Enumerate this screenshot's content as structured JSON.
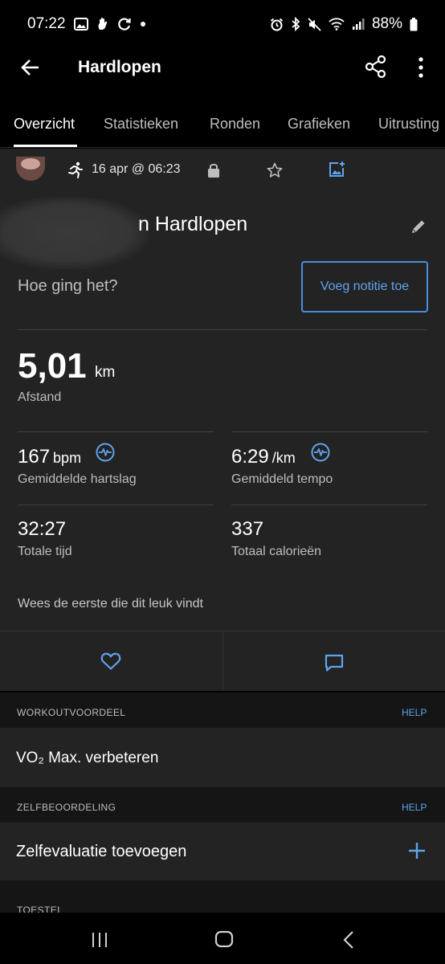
{
  "status_bar": {
    "time": "07:22",
    "battery": "88%",
    "left_icons": [
      "image-icon",
      "hand-icon",
      "sync-icon",
      "dot-icon"
    ],
    "right_icons": [
      "alarm-icon",
      "bluetooth-icon",
      "mute-icon",
      "wifi-icon",
      "signal-icon",
      "battery-icon"
    ]
  },
  "app_bar": {
    "title": "Hardlopen"
  },
  "tabs": [
    {
      "label": "Overzicht",
      "active": true
    },
    {
      "label": "Statistieken"
    },
    {
      "label": "Ronden"
    },
    {
      "label": "Grafieken"
    },
    {
      "label": "Uitrusting"
    }
  ],
  "activity": {
    "date": "16 apr @ 06:23",
    "name": "n Hardlopen",
    "feeling_prompt": "Hoe ging het?",
    "note_button": "Voeg notitie toe",
    "distance": {
      "value": "5,01",
      "unit": "km",
      "label": "Afstand"
    },
    "stats": [
      {
        "value": "167",
        "unit": "bpm",
        "label": "Gemiddelde hartslag"
      },
      {
        "value": "6:29",
        "unit": "/km",
        "label": "Gemiddeld tempo"
      },
      {
        "value": "32:27",
        "unit": "",
        "label": "Totale tijd"
      },
      {
        "value": "337",
        "unit": "",
        "label": "Totaal calorieën"
      }
    ],
    "likes_text": "Wees de eerste die dit leuk vindt"
  },
  "sections": {
    "workout_benefit": {
      "title": "WORKOUTVOORDEEL",
      "help": "HELP",
      "value": "VO₂ Max. verbeteren"
    },
    "self_evaluation": {
      "title": "ZELFBEOORDELING",
      "help": "HELP",
      "value": "Zelfevaluatie toevoegen"
    },
    "device": {
      "title": "TOESTEL"
    }
  },
  "colors": {
    "accent": "#4a8ede",
    "card": "#232323",
    "background": "#000000"
  }
}
